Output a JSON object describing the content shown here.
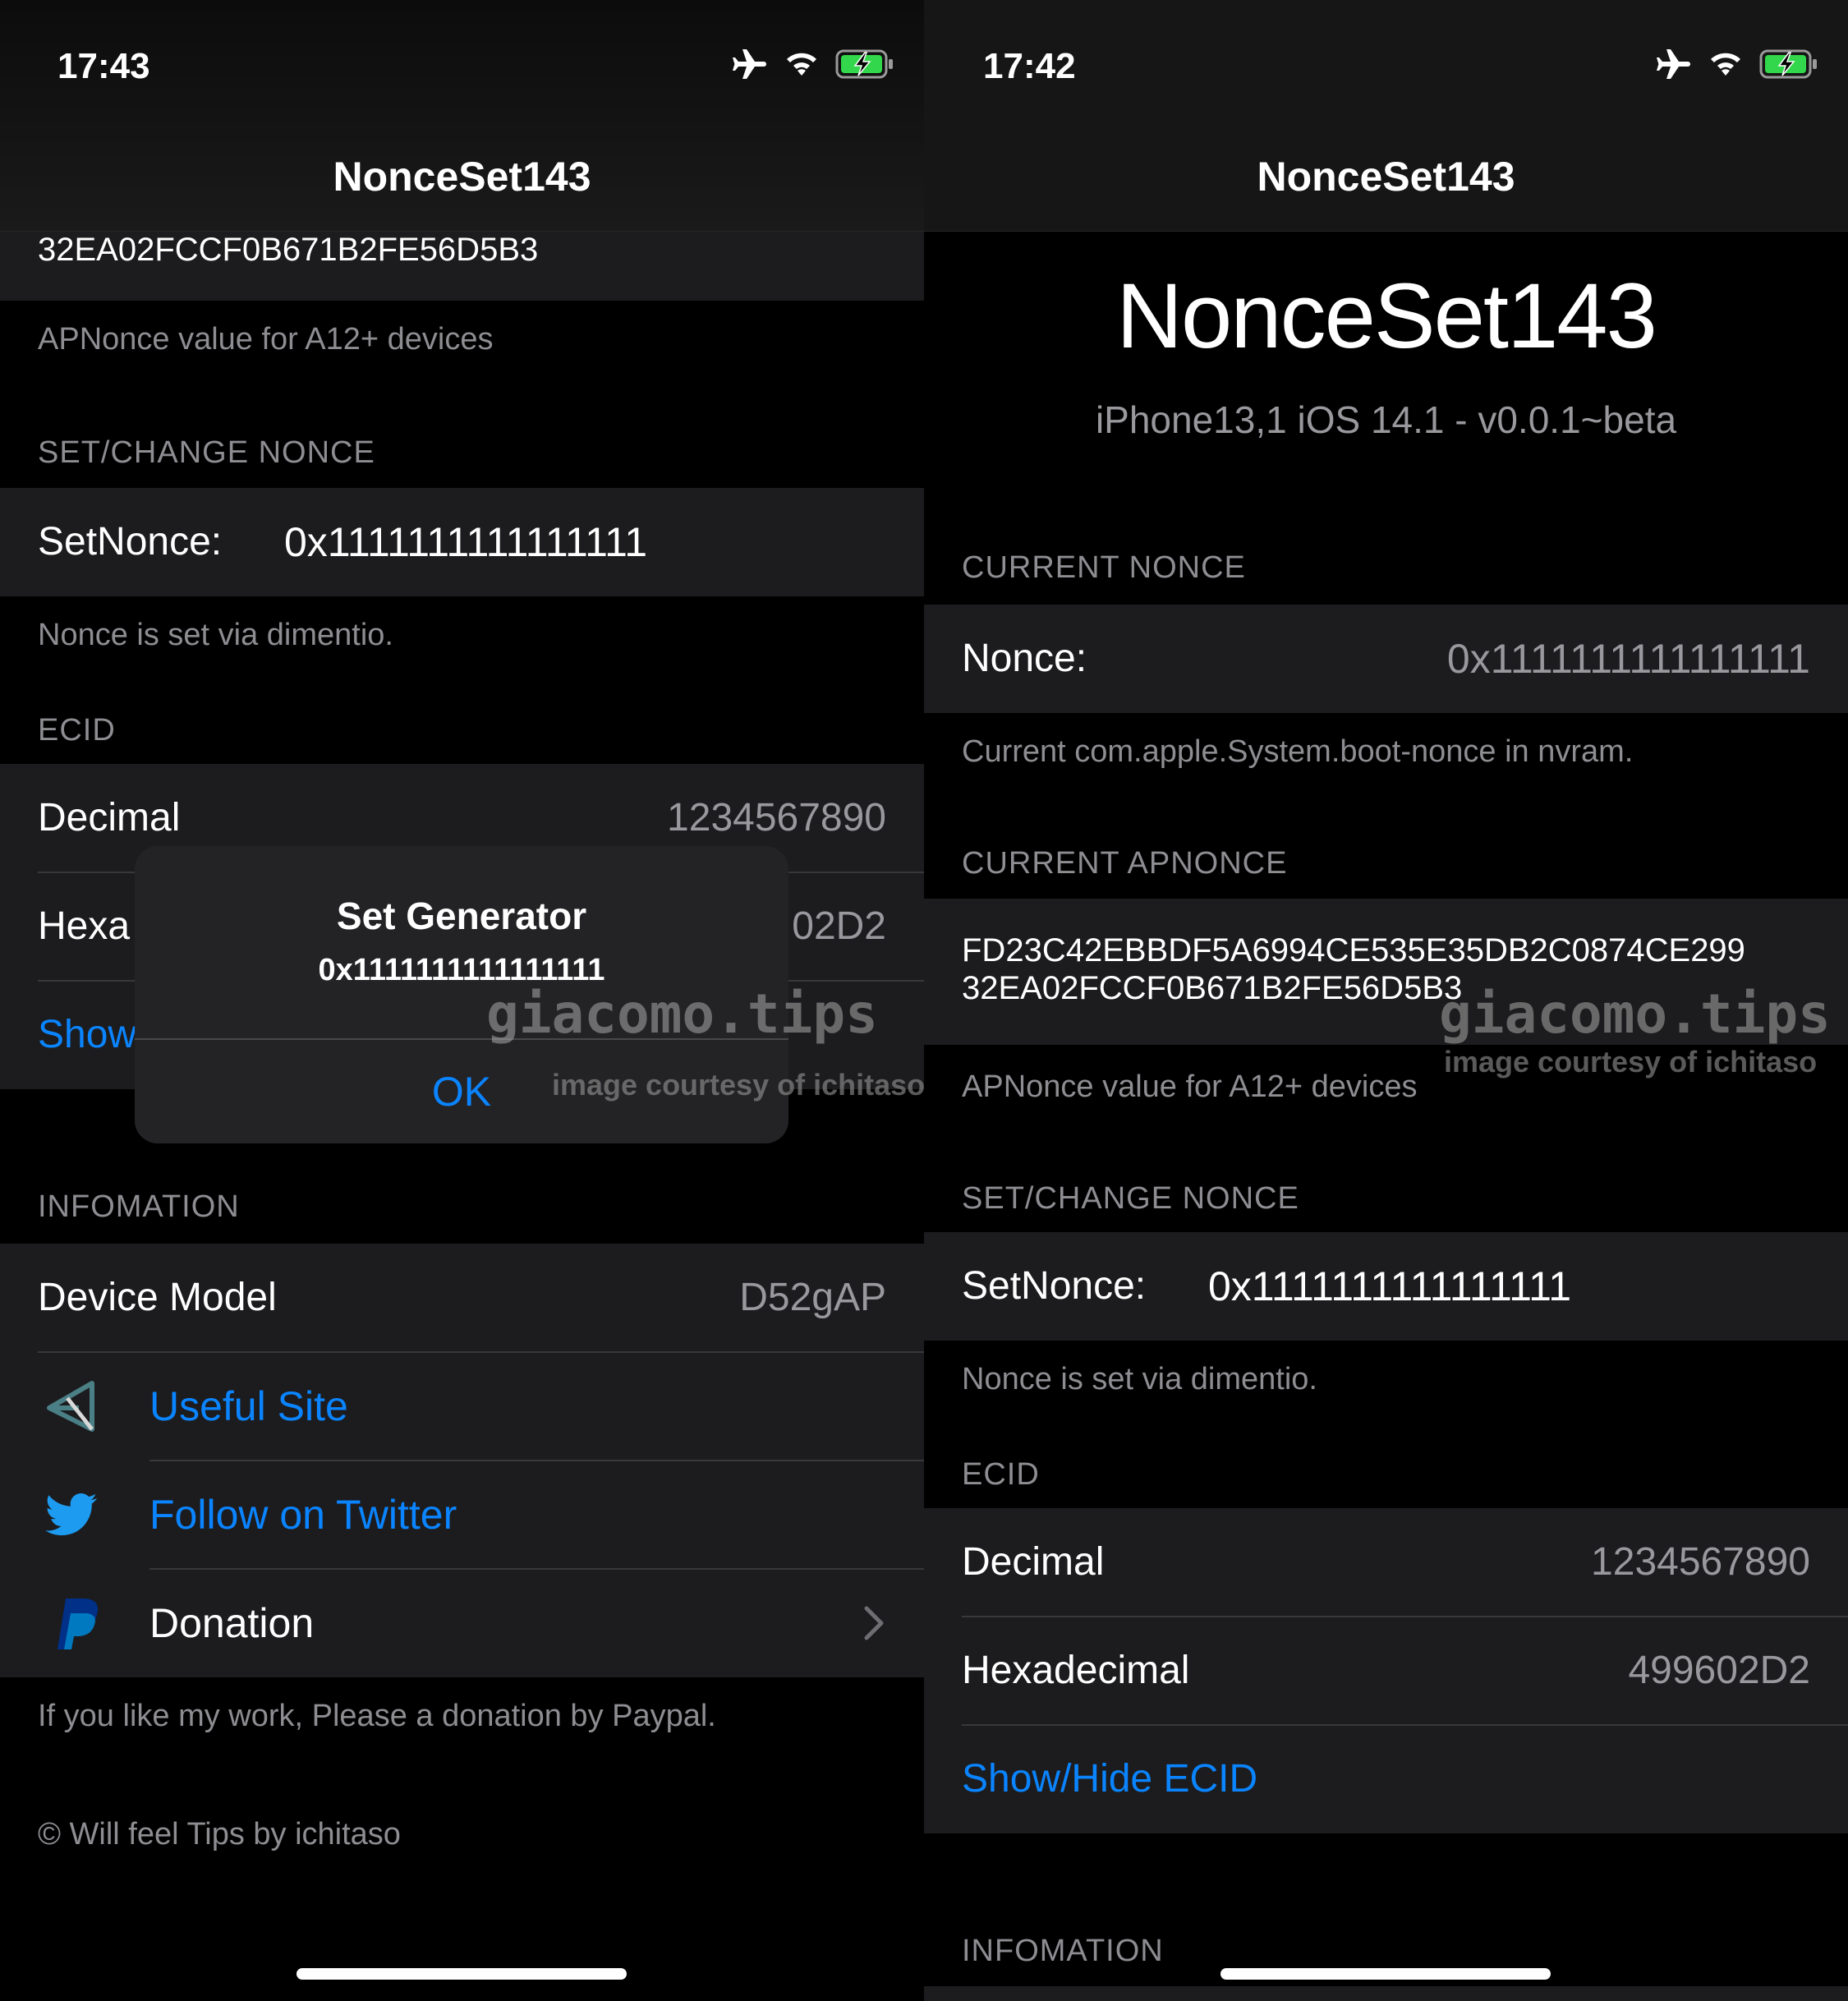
{
  "left": {
    "status_time": "17:43",
    "nav_title": "NonceSet143",
    "apnonce_tail": "32EA02FCCF0B671B2FE56D5B3",
    "apnonce_footer": "APNonce value for A12+ devices",
    "set_header": "SET/CHANGE NONCE",
    "setnonce_label": "SetNonce:",
    "setnonce_value": "0x1111111111111111",
    "setnonce_footer": "Nonce is set via dimentio.",
    "ecid_header": "ECID",
    "decimal_label": "Decimal",
    "decimal_value": "1234567890",
    "hex_label_partial": "Hexa",
    "hex_value_partial": "02D2",
    "show_partial": "Show",
    "info_header": "INFOMATION",
    "device_model_label": "Device Model",
    "device_model_value": "D52gAP",
    "useful_site": "Useful Site",
    "follow_twitter": "Follow on Twitter",
    "donation": "Donation",
    "donation_footer": "If you like my work, Please a donation by Paypal.",
    "copyright": "© Will feel Tips by ichitaso",
    "alert": {
      "title": "Set Generator",
      "message": "0x1111111111111111",
      "ok": "OK"
    }
  },
  "right": {
    "status_time": "17:42",
    "nav_title": "NonceSet143",
    "big_title": "NonceSet143",
    "subtitle": "iPhone13,1 iOS 14.1 - v0.0.1~beta",
    "current_nonce_header": "CURRENT NONCE",
    "nonce_label": "Nonce:",
    "nonce_value": "0x1111111111111111",
    "nonce_footer": "Current com.apple.System.boot-nonce in nvram.",
    "apnonce_header": "CURRENT APNONCE",
    "apnonce_line1": "FD23C42EBBDF5A6994CE535E35DB2C0874CE299",
    "apnonce_line2": "32EA02FCCF0B671B2FE56D5B3",
    "apnonce_footer": "APNonce value for A12+ devices",
    "set_header": "SET/CHANGE NONCE",
    "setnonce_label": "SetNonce:",
    "setnonce_value": "0x1111111111111111",
    "setnonce_footer": "Nonce is set via dimentio.",
    "ecid_header": "ECID",
    "decimal_label": "Decimal",
    "decimal_value": "1234567890",
    "hex_label": "Hexadecimal",
    "hex_value": "499602D2",
    "show_hide": "Show/Hide ECID",
    "info_header": "INFOMATION"
  },
  "watermark": {
    "main": "giacomo.tips",
    "sub": "image courtesy of ichitaso"
  },
  "icons": {
    "status": [
      "airplane-icon",
      "wifi-icon",
      "battery-charging-icon"
    ],
    "rows": [
      "useful-site-icon",
      "twitter-icon",
      "paypal-icon",
      "chevron-right-icon"
    ]
  },
  "colors": {
    "background": "#000000",
    "cell": "#1c1c1e",
    "link": "#0a84ff",
    "secondary_text": "#8d8d92",
    "battery": "#32d74b"
  }
}
